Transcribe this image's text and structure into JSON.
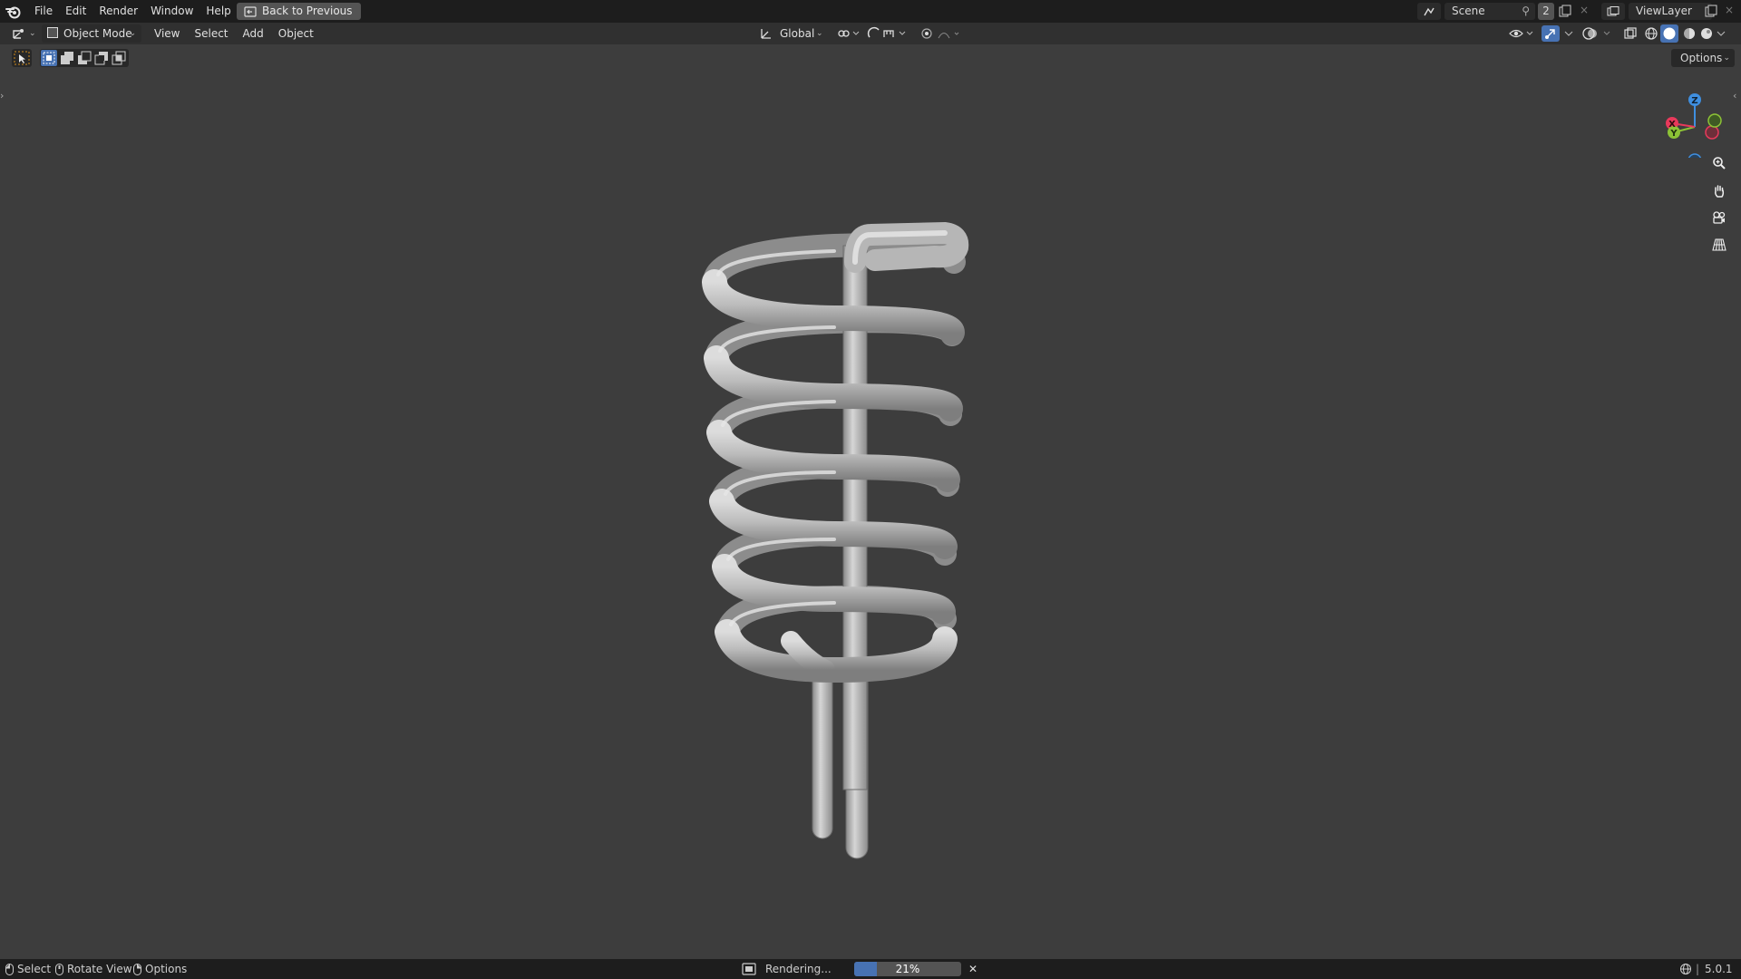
{
  "topbar": {
    "menus": [
      "File",
      "Edit",
      "Render",
      "Window",
      "Help"
    ],
    "back_label": "Back to Previous",
    "scene_name": "Scene",
    "scene_users": "2",
    "view_layer": "ViewLayer"
  },
  "header": {
    "mode": "Object Mode",
    "menus": [
      "View",
      "Select",
      "Add",
      "Object"
    ],
    "orientation": "Global",
    "options_label": "Options"
  },
  "viewport": {
    "object": "coiled tube (spring with two straight legs)",
    "gizmo_axes": [
      "Z",
      "Y",
      "X"
    ]
  },
  "statusbar": {
    "select": "Select",
    "rotate": "Rotate View",
    "options": "Options",
    "rendering": "Rendering...",
    "progress_text": "21%",
    "progress": 0.21,
    "version": "5.0.1"
  },
  "colors": {
    "accent": "#4772b3",
    "x_axis": "#e8395b",
    "y_axis": "#8cc236",
    "z_axis": "#3f8fe0"
  }
}
